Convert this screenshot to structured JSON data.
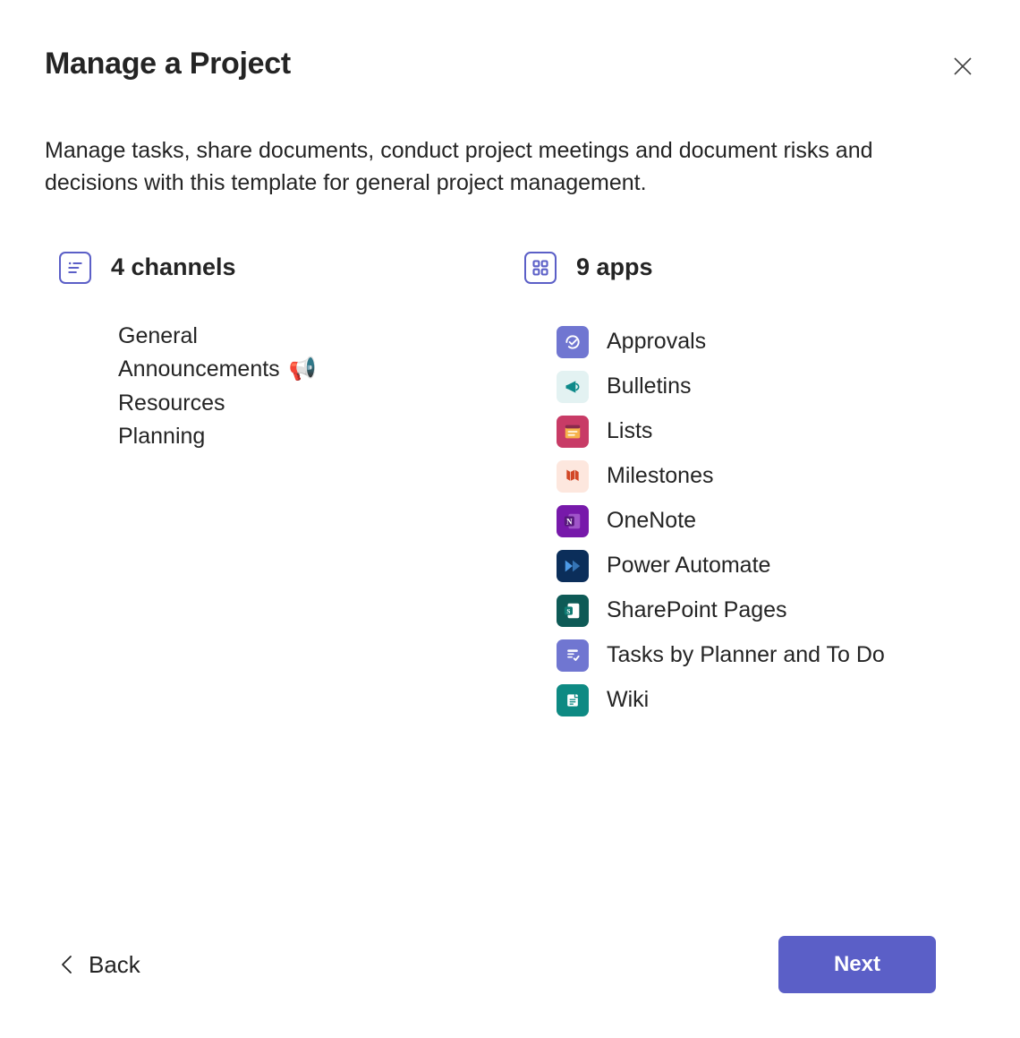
{
  "title": "Manage a Project",
  "description": "Manage tasks, share documents, conduct project meetings and document risks and decisions with this template for general project management.",
  "channels": {
    "heading": "4 channels",
    "items": [
      {
        "label": "General",
        "emoji": ""
      },
      {
        "label": "Announcements",
        "emoji": "📢"
      },
      {
        "label": "Resources",
        "emoji": ""
      },
      {
        "label": "Planning",
        "emoji": ""
      }
    ]
  },
  "apps": {
    "heading": "9 apps",
    "items": [
      {
        "label": "Approvals",
        "icon": "approvals",
        "bg": "#7076d1",
        "fg": "#ffffff"
      },
      {
        "label": "Bulletins",
        "icon": "bulletins",
        "bg": "#e3f2f2",
        "fg": "#0e8a8a"
      },
      {
        "label": "Lists",
        "icon": "lists",
        "bg": "#c83b66",
        "fg": "#f6b24a"
      },
      {
        "label": "Milestones",
        "icon": "milestones",
        "bg": "#fde7de",
        "fg": "#d24726"
      },
      {
        "label": "OneNote",
        "icon": "onenote",
        "bg": "#7719aa",
        "fg": "#ffffff"
      },
      {
        "label": "Power Automate",
        "icon": "powerautomate",
        "bg": "#0b2e5a",
        "fg": "#4d9ae6"
      },
      {
        "label": "SharePoint Pages",
        "icon": "sharepoint",
        "bg": "#0e5a56",
        "fg": "#ffffff"
      },
      {
        "label": "Tasks by Planner and To Do",
        "icon": "tasks",
        "bg": "#7076d1",
        "fg": "#ffffff"
      },
      {
        "label": "Wiki",
        "icon": "wiki",
        "bg": "#0e8a83",
        "fg": "#ffffff"
      }
    ]
  },
  "footer": {
    "back_label": "Back",
    "next_label": "Next"
  }
}
